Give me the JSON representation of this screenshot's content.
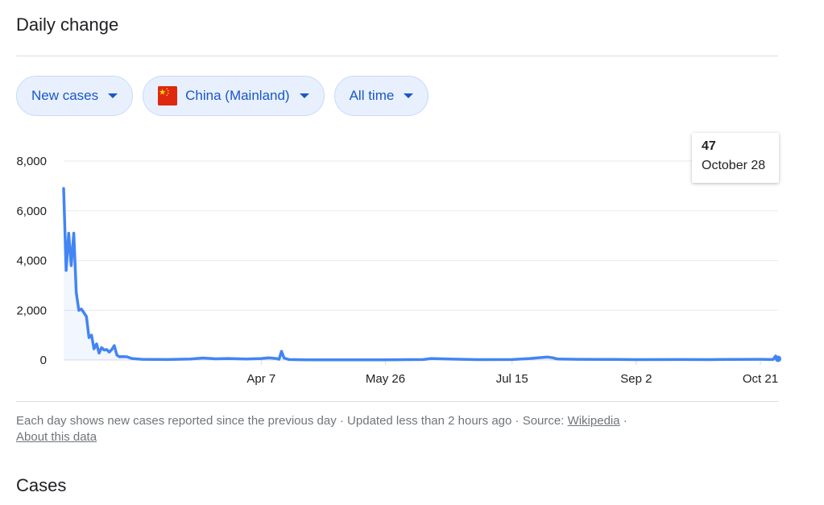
{
  "section": {
    "title": "Daily change",
    "next_title": "Cases"
  },
  "filters": {
    "metric": "New cases",
    "region": "China (Mainland)",
    "region_flag": "china-flag",
    "range": "All time"
  },
  "tooltip": {
    "value": "47",
    "date": "October 28"
  },
  "footer": {
    "text": "Each day shows new cases reported since the previous day · Updated less than 2 hours ago  ·  Source: ",
    "source_link": "Wikipedia",
    "sep": " · ",
    "about_link": "About this data"
  },
  "colors": {
    "line": "#4285f4",
    "chip_bg": "#e8f0fe",
    "chip_text": "#1a56c8",
    "grid": "#e8eaed"
  },
  "chart_data": {
    "type": "line",
    "title": "",
    "xlabel": "",
    "ylabel": "",
    "ylim": [
      0,
      8000
    ],
    "y_ticks": [
      "8,000",
      "6,000",
      "4,000",
      "2,000",
      "0"
    ],
    "y_tick_values": [
      8000,
      6000,
      4000,
      2000,
      0
    ],
    "x_ticks": [
      "Apr 7",
      "May 26",
      "Jul 15",
      "Sep 2",
      "Oct 21"
    ],
    "x_tick_values": [
      "2020-04-07",
      "2020-05-26",
      "2020-07-15",
      "2020-09-02",
      "2020-10-21"
    ],
    "x_range": [
      "2020-01-20",
      "2020-10-28"
    ],
    "grid": true,
    "series": [
      {
        "values": [
          [
            "2020-01-20",
            6900
          ],
          [
            "2020-01-21",
            3600
          ],
          [
            "2020-01-22",
            5100
          ],
          [
            "2020-01-23",
            3800
          ],
          [
            "2020-01-24",
            5100
          ],
          [
            "2020-01-25",
            2700
          ],
          [
            "2020-01-26",
            2000
          ],
          [
            "2020-01-27",
            2050
          ],
          [
            "2020-01-28",
            1900
          ],
          [
            "2020-01-29",
            1750
          ],
          [
            "2020-01-30",
            900
          ],
          [
            "2020-01-31",
            1000
          ],
          [
            "2020-02-01",
            450
          ],
          [
            "2020-02-02",
            650
          ],
          [
            "2020-02-03",
            280
          ],
          [
            "2020-02-04",
            500
          ],
          [
            "2020-02-05",
            400
          ],
          [
            "2020-02-06",
            420
          ],
          [
            "2020-02-07",
            320
          ],
          [
            "2020-02-08",
            420
          ],
          [
            "2020-02-09",
            580
          ],
          [
            "2020-02-10",
            200
          ],
          [
            "2020-02-11",
            130
          ],
          [
            "2020-02-12",
            140
          ],
          [
            "2020-02-14",
            130
          ],
          [
            "2020-02-16",
            60
          ],
          [
            "2020-02-20",
            30
          ],
          [
            "2020-03-01",
            20
          ],
          [
            "2020-03-10",
            40
          ],
          [
            "2020-03-15",
            80
          ],
          [
            "2020-03-20",
            50
          ],
          [
            "2020-03-25",
            60
          ],
          [
            "2020-04-01",
            40
          ],
          [
            "2020-04-07",
            60
          ],
          [
            "2020-04-10",
            90
          ],
          [
            "2020-04-13",
            60
          ],
          [
            "2020-04-14",
            30
          ],
          [
            "2020-04-15",
            350
          ],
          [
            "2020-04-16",
            80
          ],
          [
            "2020-04-18",
            20
          ],
          [
            "2020-04-25",
            10
          ],
          [
            "2020-05-10",
            10
          ],
          [
            "2020-05-26",
            10
          ],
          [
            "2020-06-10",
            20
          ],
          [
            "2020-06-13",
            60
          ],
          [
            "2020-06-20",
            40
          ],
          [
            "2020-07-01",
            15
          ],
          [
            "2020-07-15",
            20
          ],
          [
            "2020-07-22",
            60
          ],
          [
            "2020-07-29",
            120
          ],
          [
            "2020-07-31",
            90
          ],
          [
            "2020-08-02",
            40
          ],
          [
            "2020-08-10",
            30
          ],
          [
            "2020-08-20",
            25
          ],
          [
            "2020-09-02",
            15
          ],
          [
            "2020-09-20",
            20
          ],
          [
            "2020-10-01",
            15
          ],
          [
            "2020-10-10",
            25
          ],
          [
            "2020-10-21",
            30
          ],
          [
            "2020-10-26",
            20
          ],
          [
            "2020-10-27",
            161
          ],
          [
            "2020-10-28",
            47
          ]
        ]
      }
    ]
  }
}
